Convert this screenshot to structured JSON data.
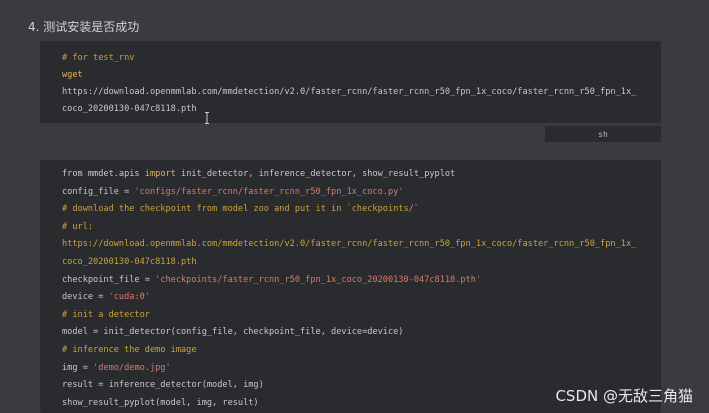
{
  "heading": "4. 测试安装是否成功",
  "block1": {
    "lines": [
      {
        "type": "comment",
        "text": "# for test_rnv"
      },
      {
        "type": "keyword",
        "text": "wget"
      },
      {
        "type": "normal",
        "text": "https://download.openmmlab.com/mmdetection/v2.0/faster_rcnn/faster_rcnn_r50_fpn_1x_coco/faster_rcnn_r50_fpn_1x_"
      },
      {
        "type": "normal",
        "text": "coco_20200130-047c8118.pth"
      }
    ]
  },
  "lang_tag": "sh",
  "block2": {
    "lines": [
      {
        "parts": [
          {
            "t": "normal",
            "v": "from mmdet.apis "
          },
          {
            "t": "keyword",
            "v": "import"
          },
          {
            "t": "normal",
            "v": " init_detector, inference_detector, show_result_pyplot"
          }
        ]
      },
      {
        "parts": [
          {
            "t": "normal",
            "v": "config_file = "
          },
          {
            "t": "string",
            "v": "'configs/faster_rcnn/faster_rcnn_r50_fpn_1x_coco.py'"
          }
        ]
      },
      {
        "parts": [
          {
            "t": "comment",
            "v": "# download the checkpoint from model zoo and put it in `checkpoints/`"
          }
        ]
      },
      {
        "parts": [
          {
            "t": "comment",
            "v": "# url:"
          }
        ]
      },
      {
        "parts": [
          {
            "t": "comment",
            "v": "https://download.openmmlab.com/mmdetection/v2.0/faster_rcnn/faster_rcnn_r50_fpn_1x_coco/faster_rcnn_r50_fpn_1x_"
          }
        ]
      },
      {
        "parts": [
          {
            "t": "comment",
            "v": "coco_20200130-047c8118.pth"
          }
        ]
      },
      {
        "parts": [
          {
            "t": "normal",
            "v": "checkpoint_file = "
          },
          {
            "t": "string",
            "v": "'checkpoints/faster_rcnn_r50_fpn_1x_coco_20200130-047c8118.pth'"
          }
        ]
      },
      {
        "parts": [
          {
            "t": "normal",
            "v": "device = "
          },
          {
            "t": "string",
            "v": "'cuda:0'"
          }
        ]
      },
      {
        "parts": [
          {
            "t": "comment",
            "v": "# init a detector"
          }
        ]
      },
      {
        "parts": [
          {
            "t": "normal",
            "v": "model = init_detector(config_file, checkpoint_file, device=device)"
          }
        ]
      },
      {
        "parts": [
          {
            "t": "comment",
            "v": "# inference the demo image"
          }
        ]
      },
      {
        "parts": [
          {
            "t": "normal",
            "v": "img = "
          },
          {
            "t": "string",
            "v": "'demo/demo.jpg'"
          }
        ]
      },
      {
        "parts": [
          {
            "t": "normal",
            "v": "result = inference_detector(model, img)"
          }
        ]
      },
      {
        "parts": [
          {
            "t": "normal",
            "v": "show_result_pyplot(model, img, result)"
          }
        ]
      }
    ]
  },
  "watermark": "CSDN @无敌三角猫",
  "colors": {
    "background": "#3a3b3f",
    "code_bg": "#2a2b2f",
    "comment": "#c9a33a",
    "keyword": "#e0b25a",
    "string": "#d97a6a",
    "text": "#c8c8c8"
  },
  "icons": {
    "cursor": "text-cursor-icon"
  }
}
